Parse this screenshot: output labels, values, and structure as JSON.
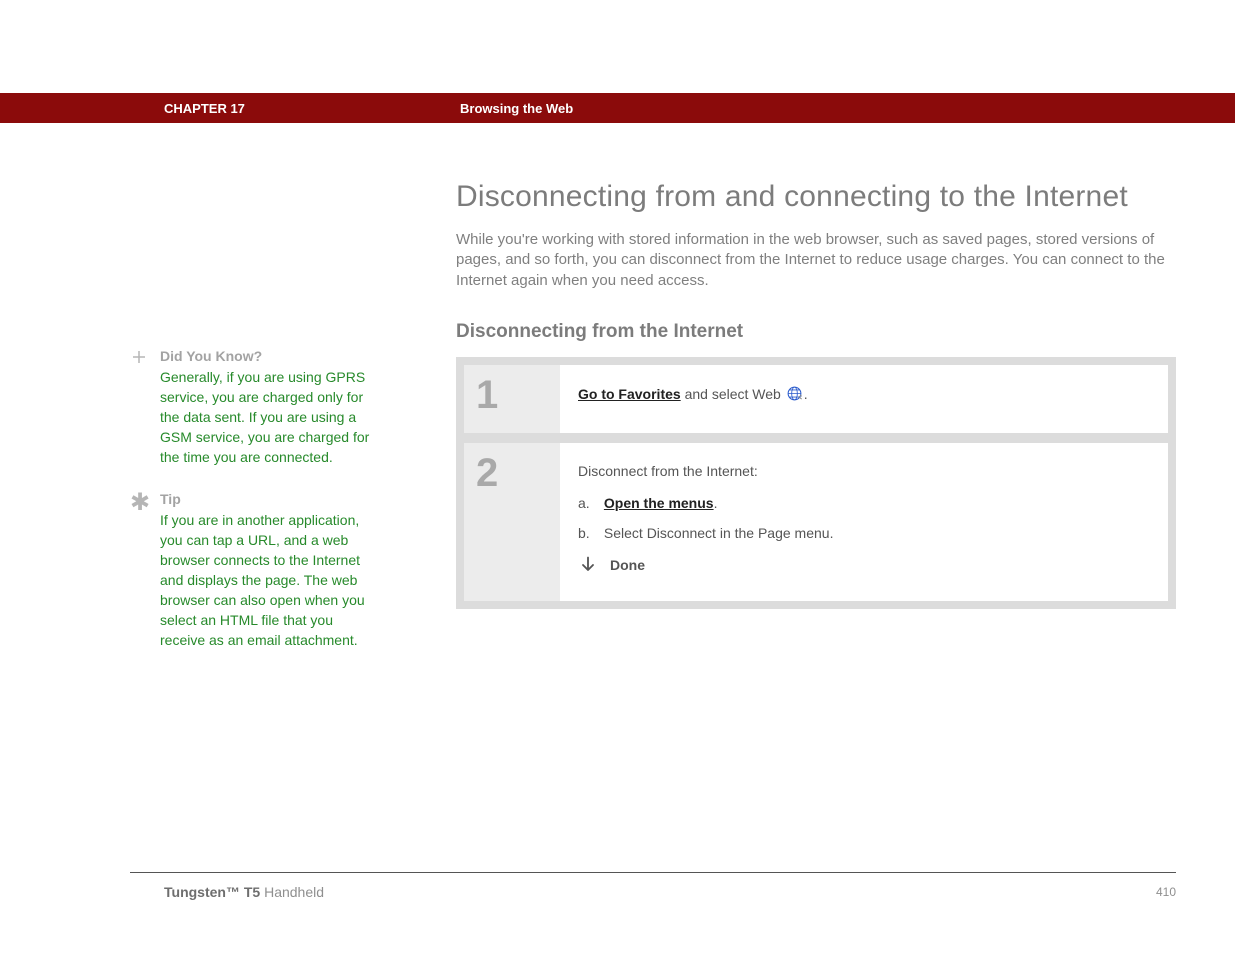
{
  "header": {
    "chapter": "CHAPTER 17",
    "topic": "Browsing the Web"
  },
  "sidebar": {
    "did_you_know": {
      "title": "Did You Know?",
      "body": "Generally, if you are using GPRS service, you are charged only for the data sent. If you are using a GSM service, you are charged for the time you are connected."
    },
    "tip": {
      "title": "Tip",
      "body": "If you are in another application, you can tap a URL, and a web browser connects to the Internet and displays the page. The web browser can also open when you select an HTML file that you receive as an email attachment."
    }
  },
  "main": {
    "title": "Disconnecting from and connecting to the Internet",
    "intro": "While you're working with stored information in the web browser, such as saved pages, stored versions of pages, and so forth, you can disconnect from the Internet to reduce usage charges. You can connect to the Internet again when you need access.",
    "section_title": "Disconnecting from the Internet",
    "steps": {
      "s1": {
        "num": "1",
        "link": "Go to Favorites",
        "after": " and select Web ",
        "tail": "."
      },
      "s2": {
        "num": "2",
        "lead": "Disconnect from the Internet:",
        "a_letter": "a.",
        "a_link": "Open the menus",
        "a_tail": ".",
        "b_letter": "b.",
        "b_text": "Select Disconnect in the Page menu.",
        "done": "Done"
      }
    }
  },
  "footer": {
    "product_bold": "Tungsten™ T5",
    "product_rest": " Handheld",
    "page": "410"
  }
}
